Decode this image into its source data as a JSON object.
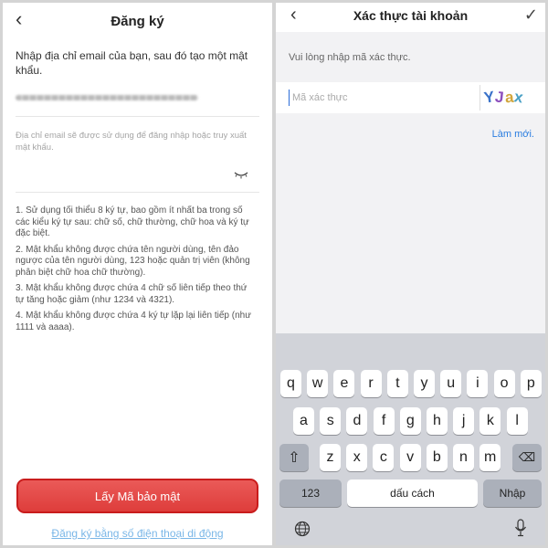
{
  "left": {
    "title": "Đăng ký",
    "back_icon": "chevron-left-icon",
    "intro": "Nhập địa chỉ email của bạn, sau đó tạo một mật khẩu.",
    "email_hint": "Địa chỉ email sẽ được sử dụng để đăng nhập hoặc truy xuất mật khẩu.",
    "password_toggle_icon": "eye-closed-icon",
    "rules": [
      "1. Sử dụng tối thiểu 8 ký tự, bao gồm ít nhất ba trong số các kiểu ký tự sau: chữ số, chữ thường, chữ hoa và ký tự đặc biệt.",
      "2. Mật khẩu không được chứa tên người dùng, tên đảo ngược của tên người dùng, 123 hoặc quản trị viên (không phân biệt chữ hoa chữ thường).",
      "3. Mật khẩu không được chứa 4 chữ số liên tiếp theo thứ tự tăng hoặc giảm (như 1234 và 4321).",
      "4. Mật khẩu không được chứa 4 ký tự lặp lại liên tiếp (như 1111 và aaaa)."
    ],
    "button_label": "Lấy Mã bảo mật",
    "phone_link": "Đăng ký bằng số điện thoại di động",
    "accent": "#e04644"
  },
  "right": {
    "title": "Xác thực tài khoản",
    "back_icon": "chevron-left-icon",
    "confirm_icon": "checkmark-icon",
    "intro": "Vui lòng nhập mã xác thực.",
    "code_placeholder": "Mã xác thực",
    "captcha_chars": [
      "Y",
      "J",
      "a",
      "x"
    ],
    "refresh_label": "Làm mới.",
    "keyboard": {
      "row1": [
        "q",
        "w",
        "e",
        "r",
        "t",
        "y",
        "u",
        "i",
        "o",
        "p"
      ],
      "row2": [
        "a",
        "s",
        "d",
        "f",
        "g",
        "h",
        "j",
        "k",
        "l"
      ],
      "row3": [
        "z",
        "x",
        "c",
        "v",
        "b",
        "n",
        "m"
      ],
      "shift_icon": "shift-icon",
      "delete_icon": "backspace-icon",
      "num_label": "123",
      "space_label": "dấu cách",
      "return_label": "Nhập",
      "globe_icon": "globe-icon",
      "mic_icon": "microphone-icon"
    }
  }
}
